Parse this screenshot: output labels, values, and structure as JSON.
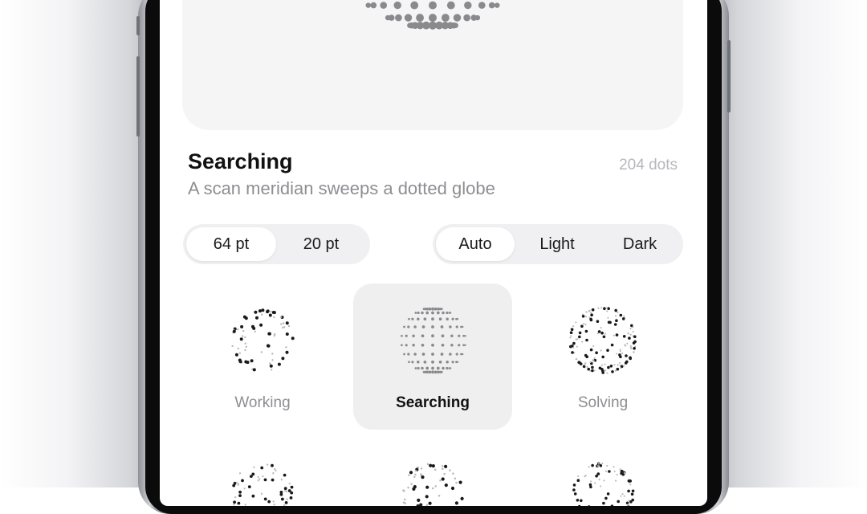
{
  "app": {
    "title": "Searching",
    "subtitle": "A scan meridian sweeps a dotted globe",
    "dot_count": "204 dots"
  },
  "size_selector": {
    "options": [
      "64 pt",
      "20 pt"
    ],
    "selected": "64 pt"
  },
  "theme_selector": {
    "options": [
      "Auto",
      "Light",
      "Dark"
    ],
    "selected": "Auto"
  },
  "animations": [
    {
      "label": "Working",
      "icon": "working-globe-icon",
      "selected": false
    },
    {
      "label": "Searching",
      "icon": "searching-globe-icon",
      "selected": true
    },
    {
      "label": "Solving",
      "icon": "solving-globe-icon",
      "selected": false
    }
  ],
  "colors": {
    "dot_gray": "#8a8a8e",
    "dot_dark": "#1a1a1a",
    "tile_selected_bg": "#efefef",
    "card_bg": "#f5f5f5"
  }
}
